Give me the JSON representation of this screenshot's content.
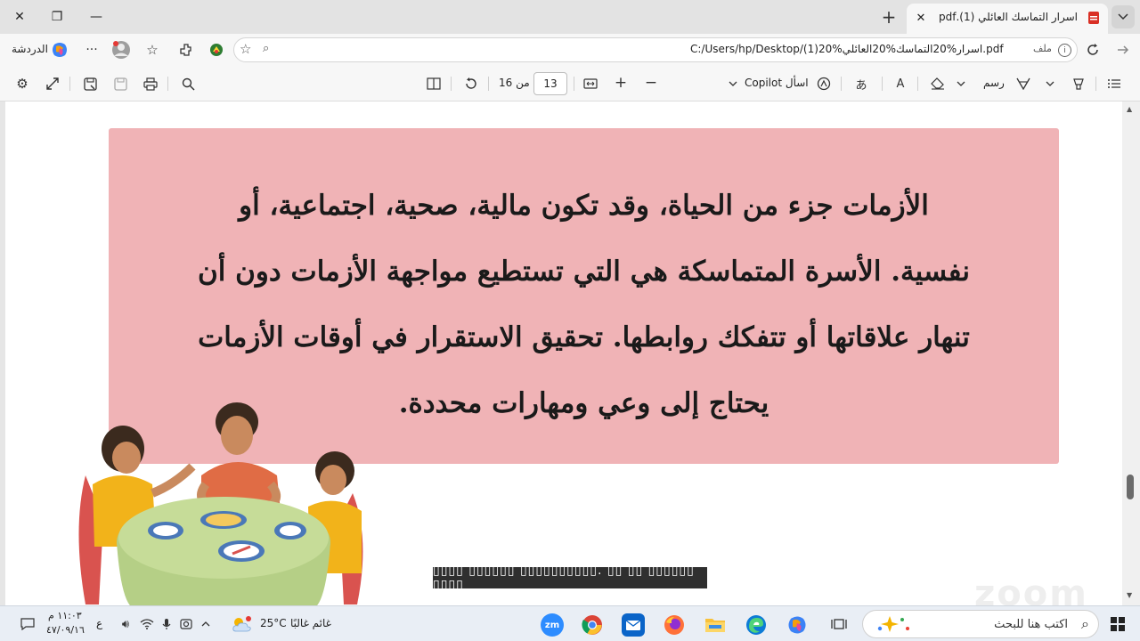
{
  "window": {
    "minimize_glyph": "—",
    "restore_glyph": "❐",
    "close_glyph": "✕"
  },
  "tab": {
    "title": "اسرار التماسك العائلي (1).pdf",
    "close_glyph": "✕",
    "new_tab_glyph": "+"
  },
  "address": {
    "url": "C:/Users/hp/Desktop/اسرار%20التماسك%20العائلي%20(1).pdf",
    "scheme_label": "ملف",
    "info_glyph": "i"
  },
  "browser_actions": {
    "copilot_label": "الدردشة",
    "more_glyph": "···"
  },
  "pdf_toolbar": {
    "current_page": "13",
    "of_label": "من 16",
    "zoom_in_glyph": "+",
    "zoom_out_glyph": "−",
    "ask_copilot_label": "اسأل Copilot",
    "draw_label": "رسم",
    "read_aloud_label": "A"
  },
  "document": {
    "lines": [
      "الأزمات جزء من الحياة، وقد تكون مالية، صحية، اجتماعية، أو",
      "نفسية. الأسرة المتماسكة هي التي تستطيع مواجهة الأزمات دون أن",
      "تنهار علاقاتها أو تتفكك روابطها. تحقيق الاستقرار في أوقات الأزمات",
      "يحتاج إلى وعي ومهارات محددة."
    ],
    "caption": "▯▯▯▯ ▯▯▯▯▯▯ ▯▯▯▯▯▯▯▯▯▯. ▯▯ ▯▯ ▯▯▯▯▯▯ ▯▯▯▯",
    "watermark": "zoom"
  },
  "taskbar": {
    "time": "١١:٠٣ م",
    "date": "٤٧/٠٩/١٦",
    "lang": "ع",
    "weather_temp": "25°C",
    "weather_desc": "غائم غالبًا",
    "search_placeholder": "اكتب هنا للبحث",
    "zoom_app_label": "zm"
  },
  "colors": {
    "pink_box": "#f0b3b6",
    "edge_blue": "#0c7bd6",
    "zoom_blue": "#2d8cff"
  }
}
